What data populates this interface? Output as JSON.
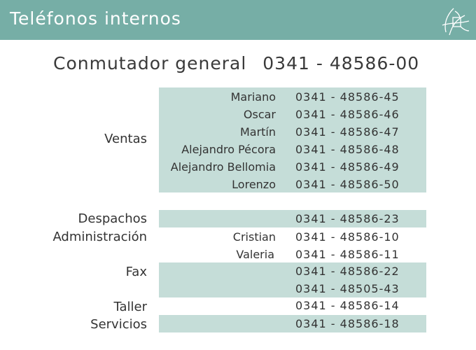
{
  "header": {
    "title": "Teléfonos internos",
    "logo_icon": "abstract-line-logo-icon",
    "background": "#76aea6"
  },
  "switchboard": {
    "label": "Conmutador general",
    "number": "0341 - 48586-00"
  },
  "colors": {
    "band": "#c5ddd8",
    "text": "#333333"
  },
  "departments": [
    {
      "name": "Ventas",
      "entries": [
        {
          "name": "Mariano",
          "phone": "0341 - 48586-45"
        },
        {
          "name": "Oscar",
          "phone": "0341 - 48586-46"
        },
        {
          "name": "Martín",
          "phone": "0341 - 48586-47"
        },
        {
          "name": "Alejandro Pécora",
          "phone": "0341 - 48586-48"
        },
        {
          "name": "Alejandro Bellomia",
          "phone": "0341 - 48586-49"
        },
        {
          "name": "Lorenzo",
          "phone": "0341 - 48586-50"
        }
      ]
    },
    {
      "name": "Despachos",
      "entries": [
        {
          "name": "",
          "phone": "0341 - 48586-23"
        }
      ]
    },
    {
      "name": "Administración",
      "entries": [
        {
          "name": "Cristian",
          "phone": "0341 - 48586-10"
        },
        {
          "name": "Valeria",
          "phone": "0341 - 48586-11"
        }
      ]
    },
    {
      "name": "Fax",
      "entries": [
        {
          "name": "",
          "phone": "0341 - 48586-22"
        },
        {
          "name": "",
          "phone": "0341 - 48505-43"
        }
      ]
    },
    {
      "name": "Taller",
      "entries": [
        {
          "name": "",
          "phone": "0341 - 48586-14"
        }
      ]
    },
    {
      "name": "Servicios",
      "entries": [
        {
          "name": "",
          "phone": "0341 - 48586-18"
        }
      ]
    }
  ]
}
